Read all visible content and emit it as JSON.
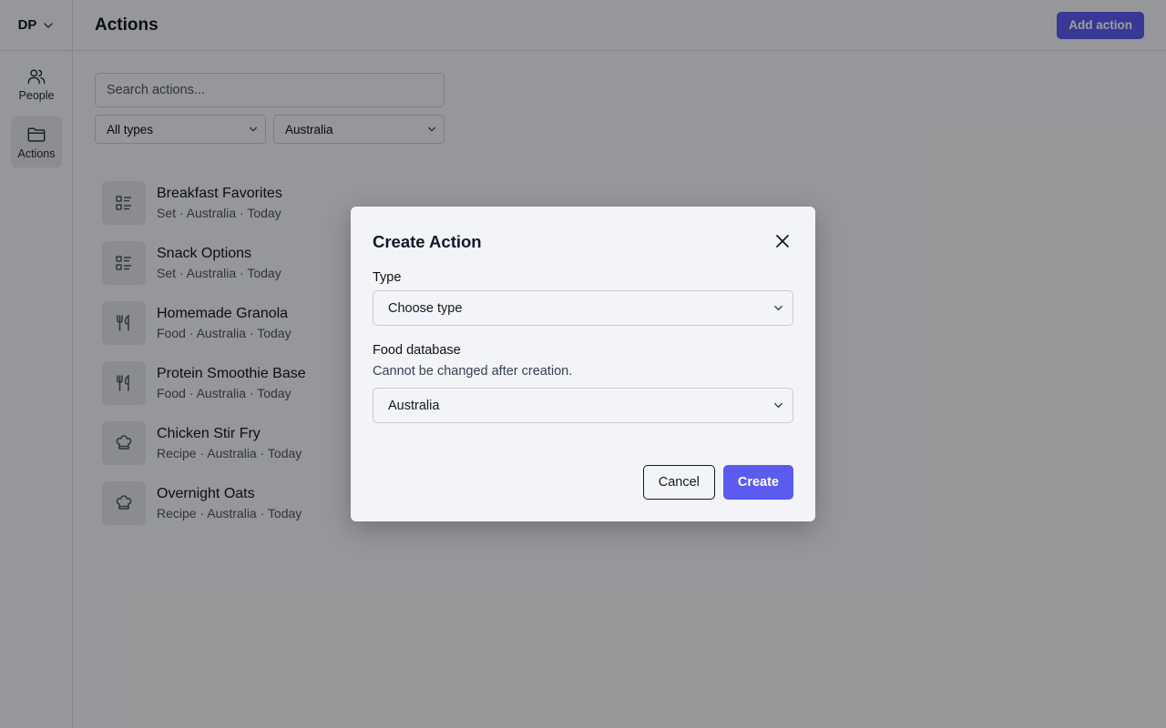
{
  "workspace": {
    "initials": "DP",
    "icon": "chevron-down-icon"
  },
  "sidebar": {
    "items": [
      {
        "label": "People",
        "icon": "people-icon",
        "active": false
      },
      {
        "label": "Actions",
        "icon": "folder-icon",
        "active": true
      }
    ]
  },
  "header": {
    "title": "Actions",
    "add_label": "Add action"
  },
  "search": {
    "placeholder": "Search actions..."
  },
  "filters": {
    "type": "All types",
    "database": "Australia"
  },
  "list": [
    {
      "title": "Breakfast Favorites",
      "meta": "Set · Australia · Today",
      "icon": "list-icon"
    },
    {
      "title": "Snack Options",
      "meta": "Set · Australia · Today",
      "icon": "list-icon"
    },
    {
      "title": "Homemade Granola",
      "meta": "Food · Australia · Today",
      "icon": "utensils-icon"
    },
    {
      "title": "Protein Smoothie Base",
      "meta": "Food · Australia · Today",
      "icon": "utensils-icon"
    },
    {
      "title": "Chicken Stir Fry",
      "meta": "Recipe · Australia · Today",
      "icon": "chef-hat-icon"
    },
    {
      "title": "Overnight Oats",
      "meta": "Recipe · Australia · Today",
      "icon": "chef-hat-icon"
    }
  ],
  "modal": {
    "title": "Create Action",
    "type_label": "Type",
    "type_value": "Choose type",
    "db_label": "Food database",
    "db_help": "Cannot be changed after creation.",
    "db_value": "Australia",
    "cancel_label": "Cancel",
    "create_label": "Create"
  },
  "colors": {
    "accent": "#5b5bf0",
    "background": "#f3f4f8",
    "overlay": "rgba(0,0,0,0.38)"
  }
}
